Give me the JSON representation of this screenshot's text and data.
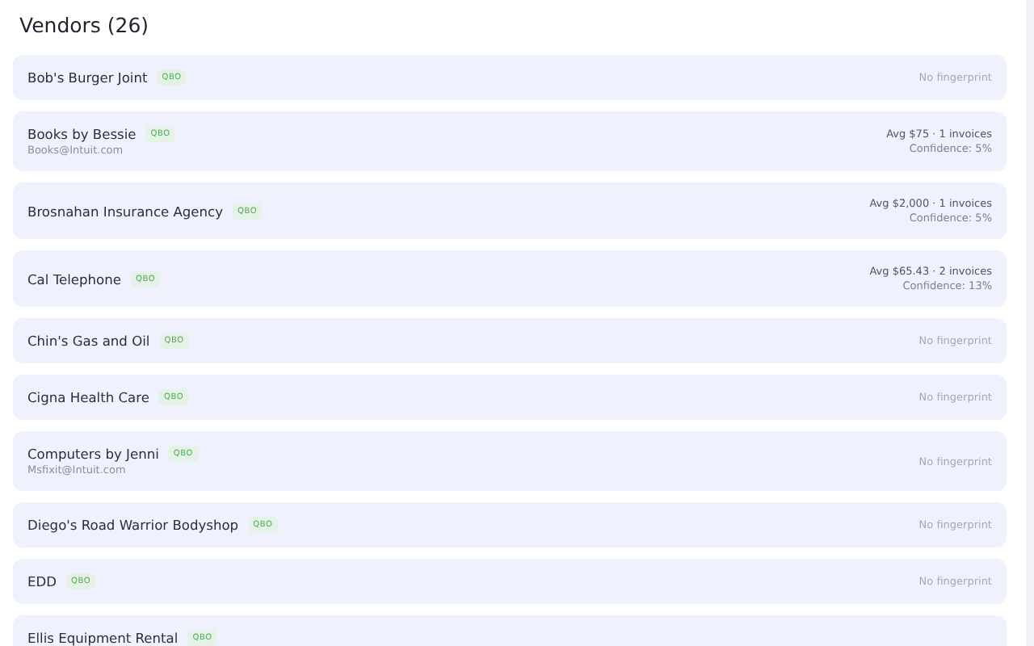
{
  "title": "Vendors (26)",
  "vendors": [
    {
      "name": "Bob's Burger Joint",
      "badge": "QBO",
      "note": "No fingerprint"
    },
    {
      "name": "Books by Bessie",
      "badge": "QBO",
      "email": "Books@Intuit.com",
      "stats": "Avg $75 · 1 invoices",
      "confidence": "Confidence: 5%"
    },
    {
      "name": "Brosnahan Insurance Agency",
      "badge": "QBO",
      "stats": "Avg $2,000 · 1 invoices",
      "confidence": "Confidence: 5%"
    },
    {
      "name": "Cal Telephone",
      "badge": "QBO",
      "stats": "Avg $65.43 · 2 invoices",
      "confidence": "Confidence: 13%"
    },
    {
      "name": "Chin's Gas and Oil",
      "badge": "QBO",
      "note": "No fingerprint"
    },
    {
      "name": "Cigna Health Care",
      "badge": "QBO",
      "note": "No fingerprint"
    },
    {
      "name": "Computers by Jenni",
      "badge": "QBO",
      "email": "Msfixit@Intuit.com",
      "note": "No fingerprint"
    },
    {
      "name": "Diego's Road Warrior Bodyshop",
      "badge": "QBO",
      "note": "No fingerprint"
    },
    {
      "name": "EDD",
      "badge": "QBO",
      "note": "No fingerprint"
    },
    {
      "name": "Ellis Equipment Rental",
      "badge": "QBO"
    }
  ]
}
